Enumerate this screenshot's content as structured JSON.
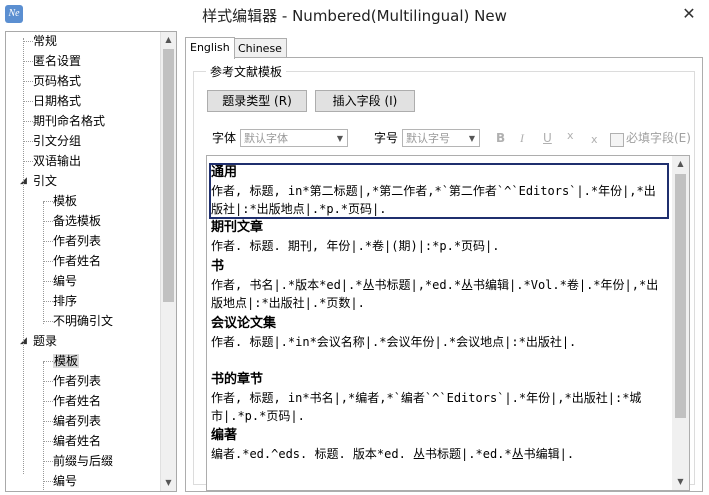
{
  "window": {
    "title": "样式编辑器 - Numbered(Multilingual) New",
    "close_label": "✕",
    "icon_label": "Ne"
  },
  "tree": {
    "items": [
      {
        "label": "常规",
        "level": 0
      },
      {
        "label": "匿名设置",
        "level": 0
      },
      {
        "label": "页码格式",
        "level": 0
      },
      {
        "label": "日期格式",
        "level": 0
      },
      {
        "label": "期刊命名格式",
        "level": 0
      },
      {
        "label": "引文分组",
        "level": 0
      },
      {
        "label": "双语输出",
        "level": 0
      },
      {
        "label": "引文",
        "level": 0,
        "expanded": true
      },
      {
        "label": "模板",
        "level": 1
      },
      {
        "label": "备选模板",
        "level": 1
      },
      {
        "label": "作者列表",
        "level": 1
      },
      {
        "label": "作者姓名",
        "level": 1
      },
      {
        "label": "编号",
        "level": 1
      },
      {
        "label": "排序",
        "level": 1
      },
      {
        "label": "不明确引文",
        "level": 1
      },
      {
        "label": "题录",
        "level": 0,
        "expanded": true
      },
      {
        "label": "模板",
        "level": 1,
        "selected": true
      },
      {
        "label": "作者列表",
        "level": 1
      },
      {
        "label": "作者姓名",
        "level": 1
      },
      {
        "label": "编者列表",
        "level": 1
      },
      {
        "label": "编者姓名",
        "level": 1
      },
      {
        "label": "前缀与后缀",
        "level": 1
      },
      {
        "label": "编号",
        "level": 1
      }
    ]
  },
  "tabs": [
    {
      "label": "English",
      "active": true
    },
    {
      "label": "Chinese",
      "active": false
    }
  ],
  "group": {
    "label": "参考文献模板",
    "ref_type_button": "题录类型 (R)",
    "insert_field_button": "插入字段 (I)",
    "font_label": "字体",
    "font_placeholder": "默认字体",
    "size_label": "字号",
    "size_placeholder": "默认字号",
    "bold": "B",
    "italic": "I",
    "underline": "U",
    "sup": "x",
    "sub": "x",
    "required_label": "必填字段(E)"
  },
  "editor": {
    "sections": [
      {
        "title": "通用",
        "body": "作者, 标题, in*第二标题|,*第二作者,*`第二作者`^`Editors`|.*年份|,*出版社|:*出版地点|.*p.*页码|."
      },
      {
        "title": "期刊文章",
        "body": "作者. 标题. 期刊, 年份|.*卷|(期)|:*p.*页码|."
      },
      {
        "title": "书",
        "body": "作者, 书名|.*版本*ed|.*丛书标题|,*ed.*丛书编辑|.*Vol.*卷|.*年份|,*出版地点|:*出版社|.*页数|."
      },
      {
        "title": "会议论文集",
        "body": "作者. 标题|.*in*会议名称|.*会议年份|.*会议地点|:*出版社|."
      },
      {
        "title": "书的章节",
        "body": "作者, 标题, in*书名|,*编者,*`编者`^`Editors`|.*年份|,*出版社|:*城市|.*p.*页码|."
      },
      {
        "title": "编著",
        "body": "编者.*ed.^eds. 标题. 版本*ed. 丛书标题|.*ed.*丛书编辑|."
      }
    ]
  }
}
